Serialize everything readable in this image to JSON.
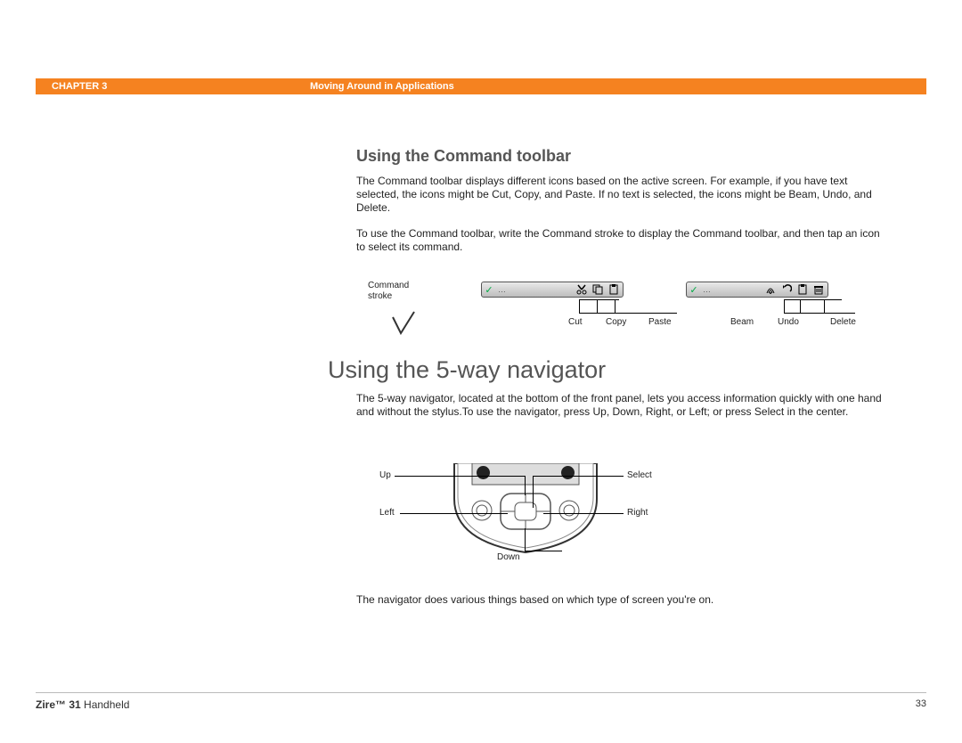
{
  "header": {
    "chapter": "CHAPTER 3",
    "title": "Moving Around in Applications"
  },
  "section1": {
    "heading": "Using the Command toolbar",
    "para1": "The Command toolbar displays different icons based on the active screen. For example, if you have text selected, the icons might be Cut, Copy, and Paste. If no text is selected, the icons might be Beam, Undo, and Delete.",
    "para2": "To use the Command toolbar, write the Command stroke to display the Command toolbar, and then tap an icon to select its command."
  },
  "toolbar_fig": {
    "stroke_label_l1": "Command",
    "stroke_label_l2": "stroke",
    "left": {
      "labels": {
        "cut": "Cut",
        "copy": "Copy",
        "paste": "Paste"
      }
    },
    "right": {
      "labels": {
        "beam": "Beam",
        "undo": "Undo",
        "delete": "Delete"
      }
    }
  },
  "section2": {
    "heading": "Using the 5-way navigator",
    "para1": "The 5-way navigator, located at the bottom of the front panel, lets you access information quickly with one hand and without the stylus.To use the navigator, press Up, Down, Right, or Left; or press Select in the center.",
    "para2": "The navigator does various things based on which type of screen you're on."
  },
  "navigator_fig": {
    "up": "Up",
    "down": "Down",
    "left": "Left",
    "right": "Right",
    "select": "Select"
  },
  "footer": {
    "product_bold": "Zire™ 31",
    "product_rest": " Handheld",
    "page": "33"
  }
}
